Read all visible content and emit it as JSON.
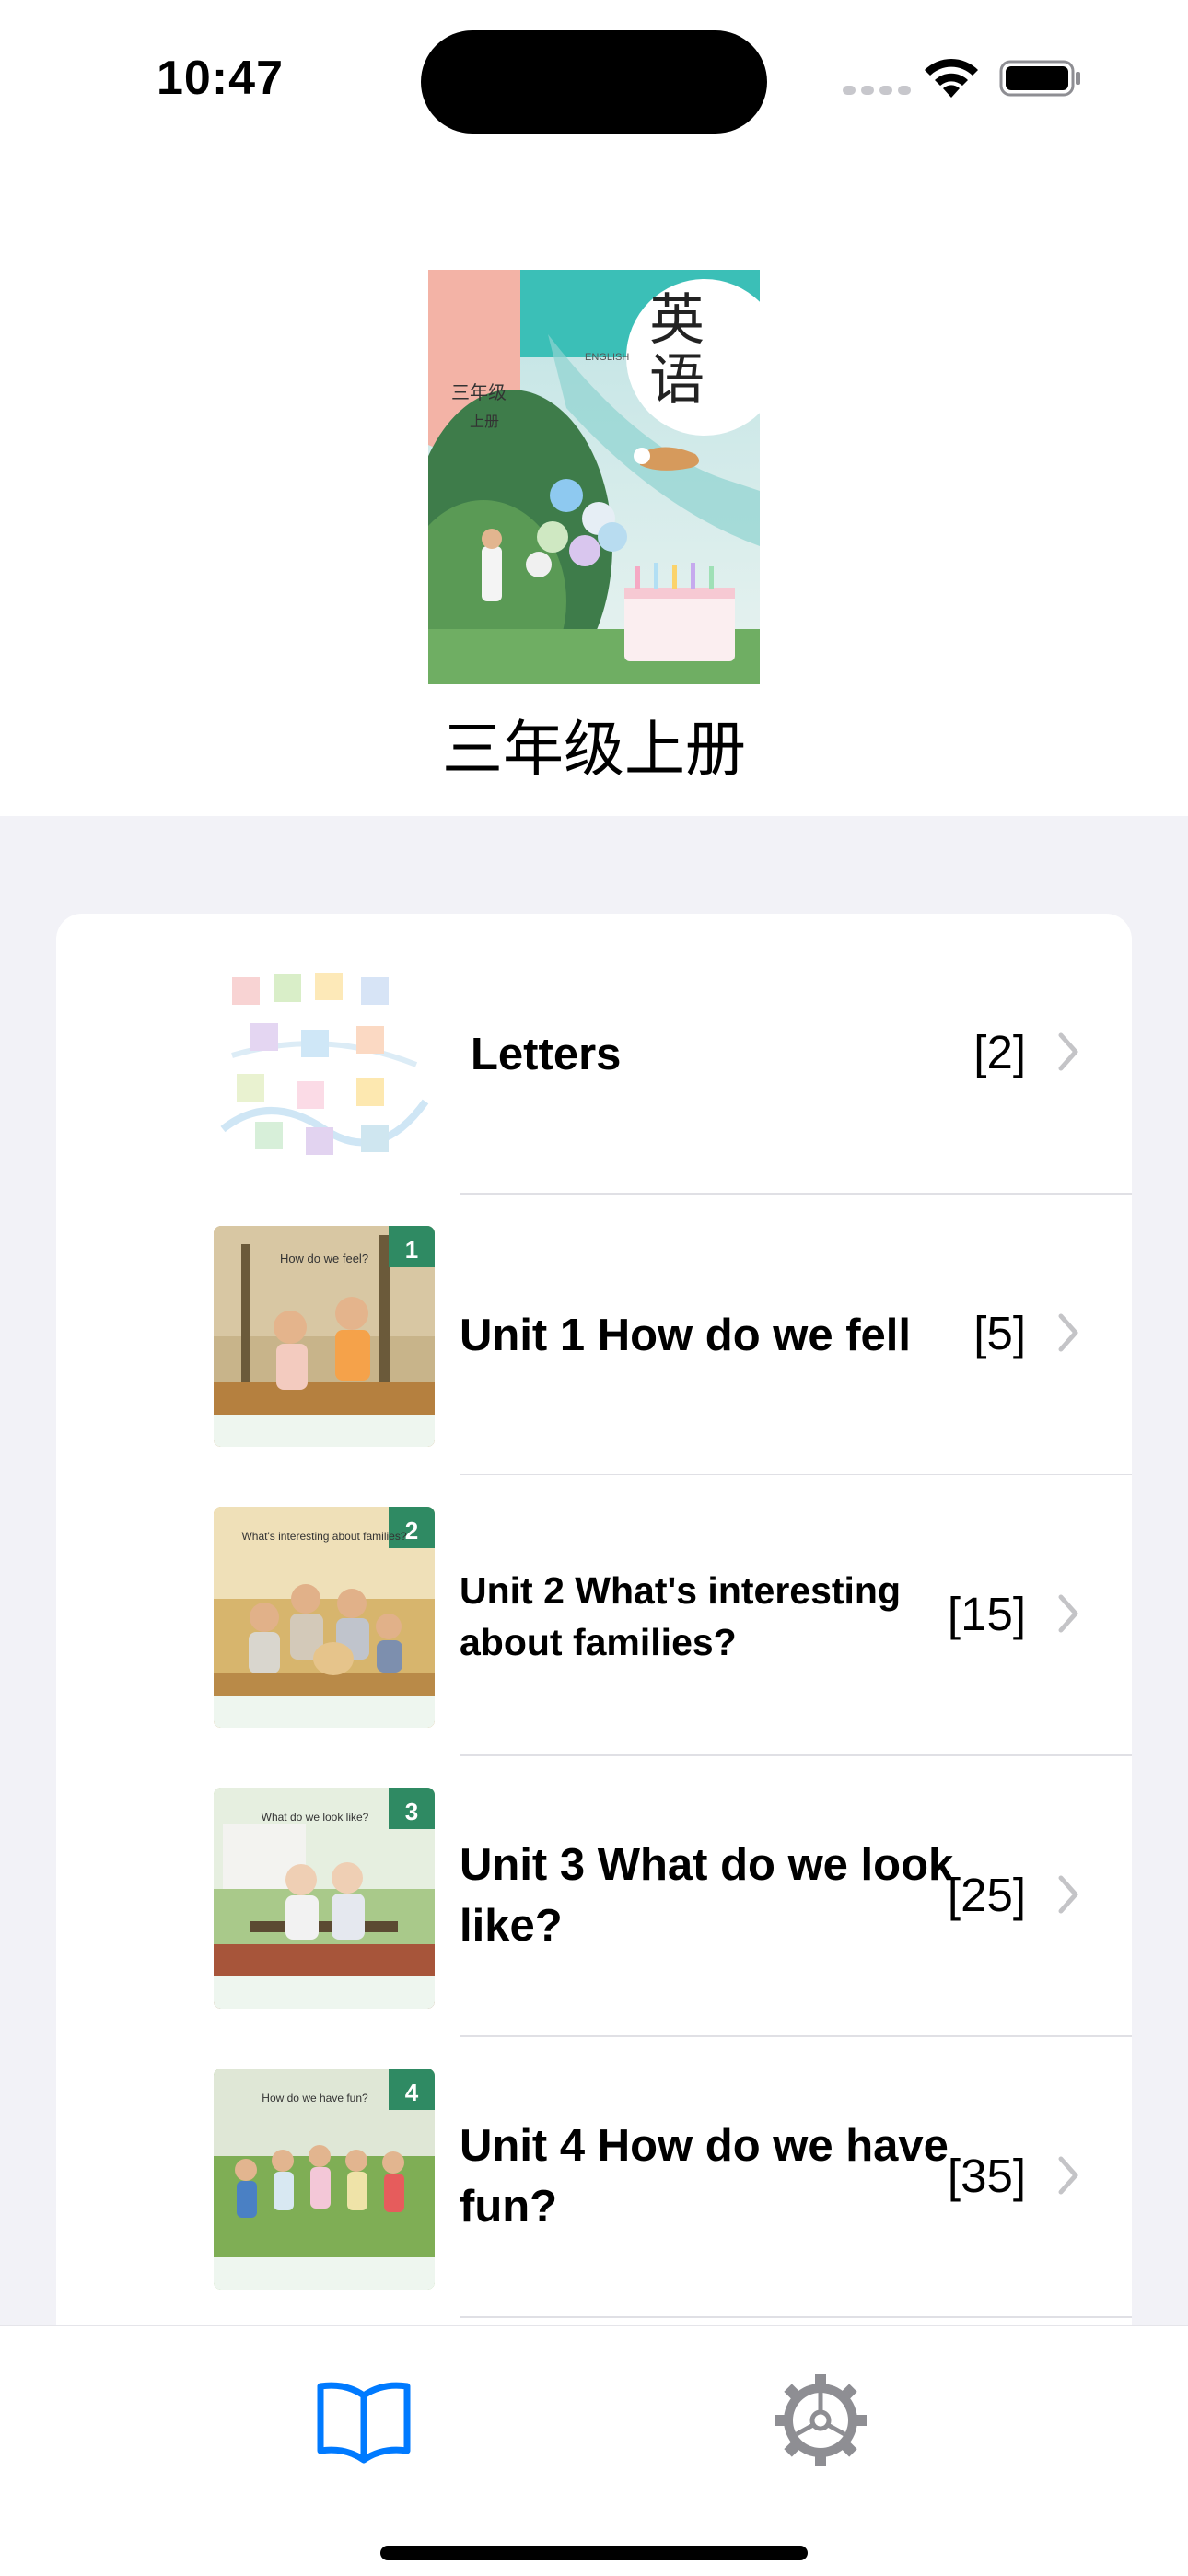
{
  "status_bar": {
    "time": "10:47"
  },
  "header": {
    "cover": {
      "grade_text": "三年级",
      "volume_text": "上册",
      "english_text": "ENGLISH",
      "subject_char1": "英",
      "subject_char2": "语"
    },
    "book_title": "三年级上册"
  },
  "list": [
    {
      "title": "Letters",
      "count": "[2]",
      "thumb_text": ""
    },
    {
      "title": "Unit 1 How do we fell",
      "count": "[5]",
      "thumb_text": "How do we feel?",
      "unit_num": "1"
    },
    {
      "title": "Unit 2 What's interesting about families?",
      "count": "[15]",
      "thumb_text": "What's interesting about families?",
      "unit_num": "2"
    },
    {
      "title": "Unit 3 What do we look like?",
      "count": "[25]",
      "thumb_text": "What do we look like?",
      "unit_num": "3"
    },
    {
      "title": "Unit 4 How do we have fun?",
      "count": "[35]",
      "thumb_text": "How do we have fun?",
      "unit_num": "4"
    }
  ],
  "tab_bar": {
    "tabs": [
      {
        "icon": "book-icon",
        "selected": true
      },
      {
        "icon": "gear-icon",
        "selected": false
      }
    ]
  },
  "colors": {
    "accent": "#007aff",
    "inactive": "#8e8e93",
    "background": "#f2f2f7"
  }
}
